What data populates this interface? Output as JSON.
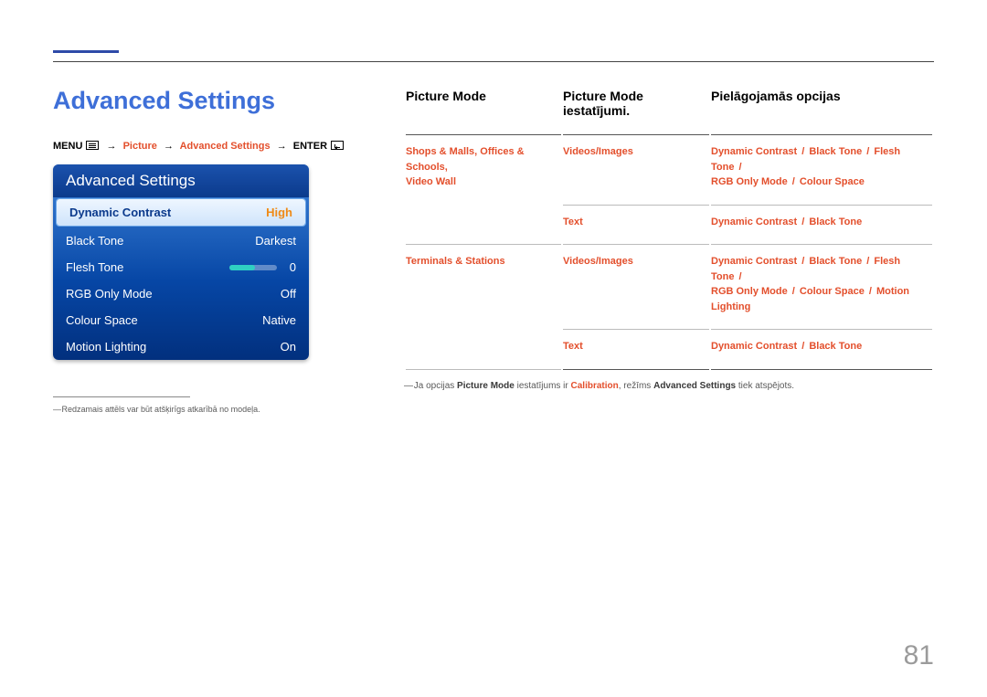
{
  "page_number": "81",
  "heading": "Advanced Settings",
  "breadcrumb": {
    "menu": "MENU",
    "arrow": "→",
    "picture": "Picture",
    "advanced": "Advanced Settings",
    "enter": "ENTER"
  },
  "osd": {
    "title": "Advanced Settings",
    "rows": [
      {
        "label": "Dynamic Contrast",
        "value": "High",
        "selected": true
      },
      {
        "label": "Black Tone",
        "value": "Darkest"
      },
      {
        "label": "Flesh Tone",
        "value": "0",
        "slider": true
      },
      {
        "label": "RGB Only Mode",
        "value": "Off"
      },
      {
        "label": "Colour Space",
        "value": "Native"
      },
      {
        "label": "Motion Lighting",
        "value": "On"
      }
    ]
  },
  "footnote_left": "Redzamais attēls var būt atšķirīgs atkarībā no modeļa.",
  "table": {
    "headers": [
      "Picture Mode",
      "Picture Mode iestatījumi.",
      "Pielāgojamās opcijas"
    ],
    "rows": [
      {
        "c1_lines": [
          "Shops & Malls, Offices & Schools,",
          "Video Wall"
        ],
        "c2": "Videos/Images",
        "c3_tokens": [
          "Dynamic Contrast",
          "Black Tone",
          "Flesh Tone",
          "RGB Only Mode",
          "Colour Space"
        ]
      },
      {
        "c1_lines": [],
        "c2": "Text",
        "c3_tokens": [
          "Dynamic Contrast",
          "Black Tone"
        ]
      },
      {
        "c1_lines": [
          "Terminals & Stations"
        ],
        "c2": "Videos/Images",
        "c3_tokens": [
          "Dynamic Contrast",
          "Black Tone",
          "Flesh Tone",
          "RGB Only Mode",
          "Colour Space",
          "Motion Lighting"
        ]
      },
      {
        "c1_lines": [],
        "c2": "Text",
        "c3_tokens": [
          "Dynamic Contrast",
          "Black Tone"
        ]
      }
    ]
  },
  "note_right": {
    "pre": "Ja opcijas ",
    "b1": "Picture Mode",
    "mid1": " iestatījums ir ",
    "r1": "Calibration",
    "mid2": ", režīms ",
    "b2": "Advanced Settings",
    "post": " tiek atspējots."
  }
}
